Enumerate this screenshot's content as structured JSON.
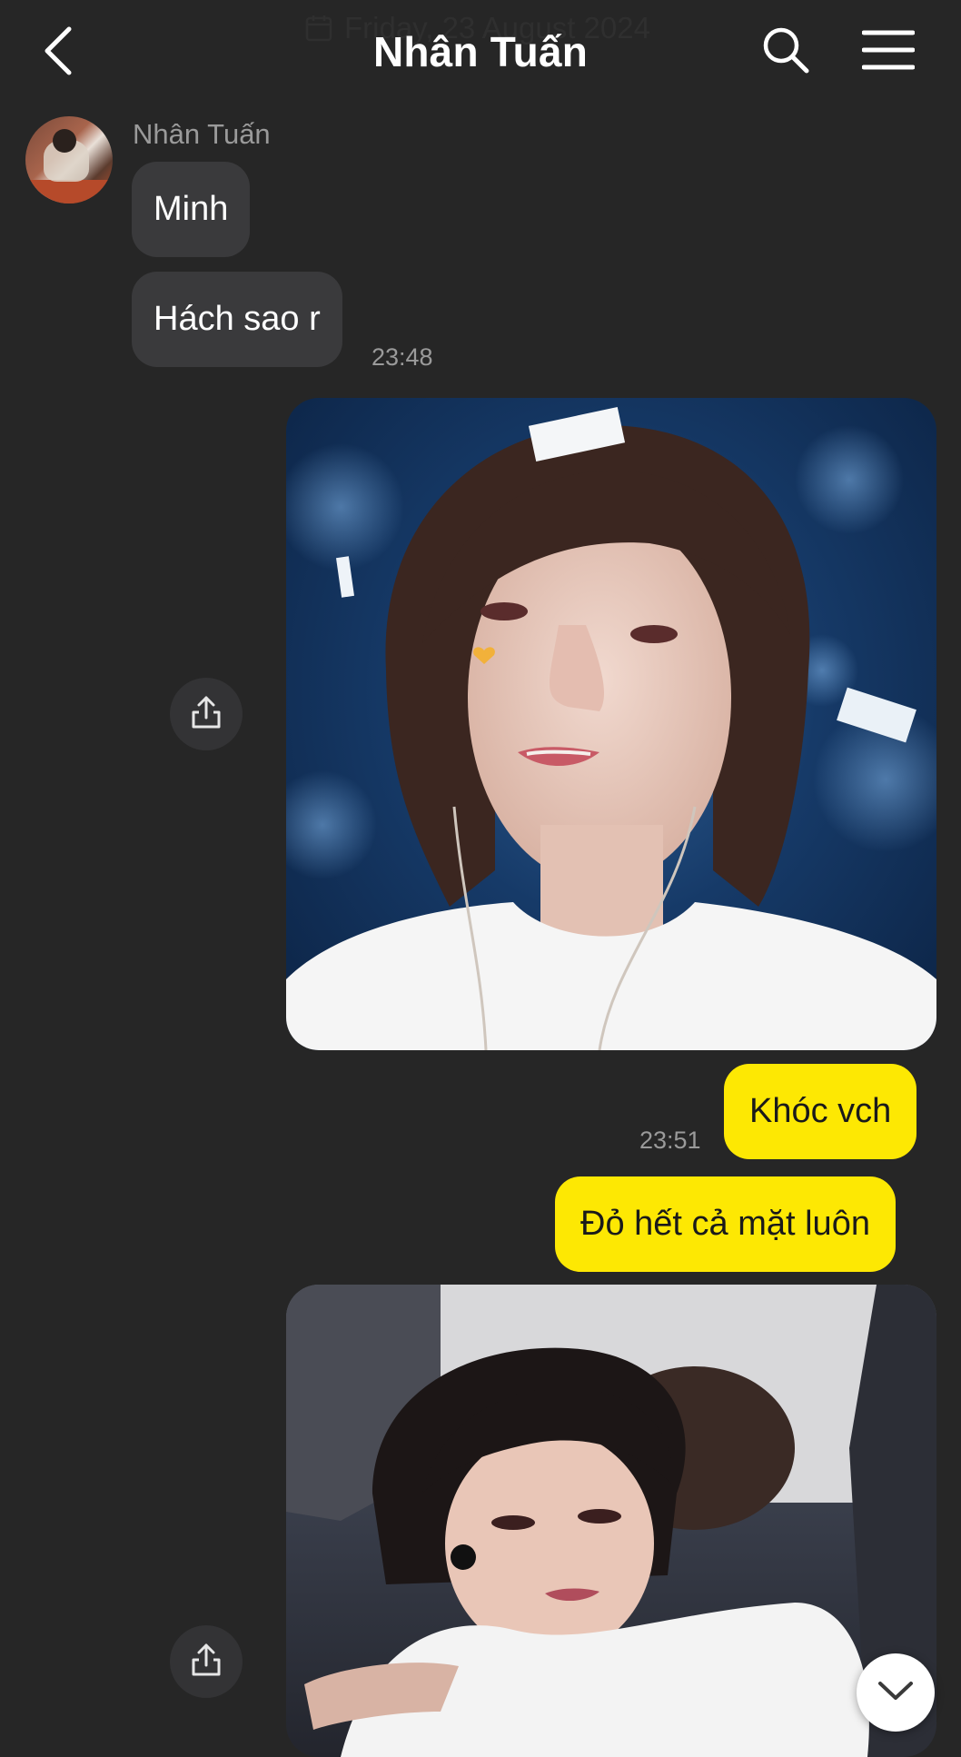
{
  "header": {
    "back_icon": "chevron-left-icon",
    "title": "Nhân Tuấn",
    "search_icon": "search-icon",
    "menu_icon": "hamburger-menu-icon",
    "date_ghost": "Friday, 23 August 2024",
    "date_icon": "calendar-icon"
  },
  "incoming": {
    "sender_name": "Nhân Tuấn",
    "messages": [
      "Minh",
      "Hách sao r"
    ],
    "time": "23:48"
  },
  "outgoing": {
    "messages": [
      "Khóc vch",
      "Đỏ hết cả mặt luôn"
    ],
    "time": "23:51"
  },
  "photos": [
    {
      "description_icon": "photo-crying-singer"
    },
    {
      "description_icon": "photo-hug"
    }
  ],
  "controls": {
    "share_icon": "share-icon",
    "scroll_down_icon": "chevron-down-icon"
  },
  "colors": {
    "background": "#262626",
    "incoming_bubble": "#3a3a3c",
    "outgoing_bubble": "#fde803"
  }
}
